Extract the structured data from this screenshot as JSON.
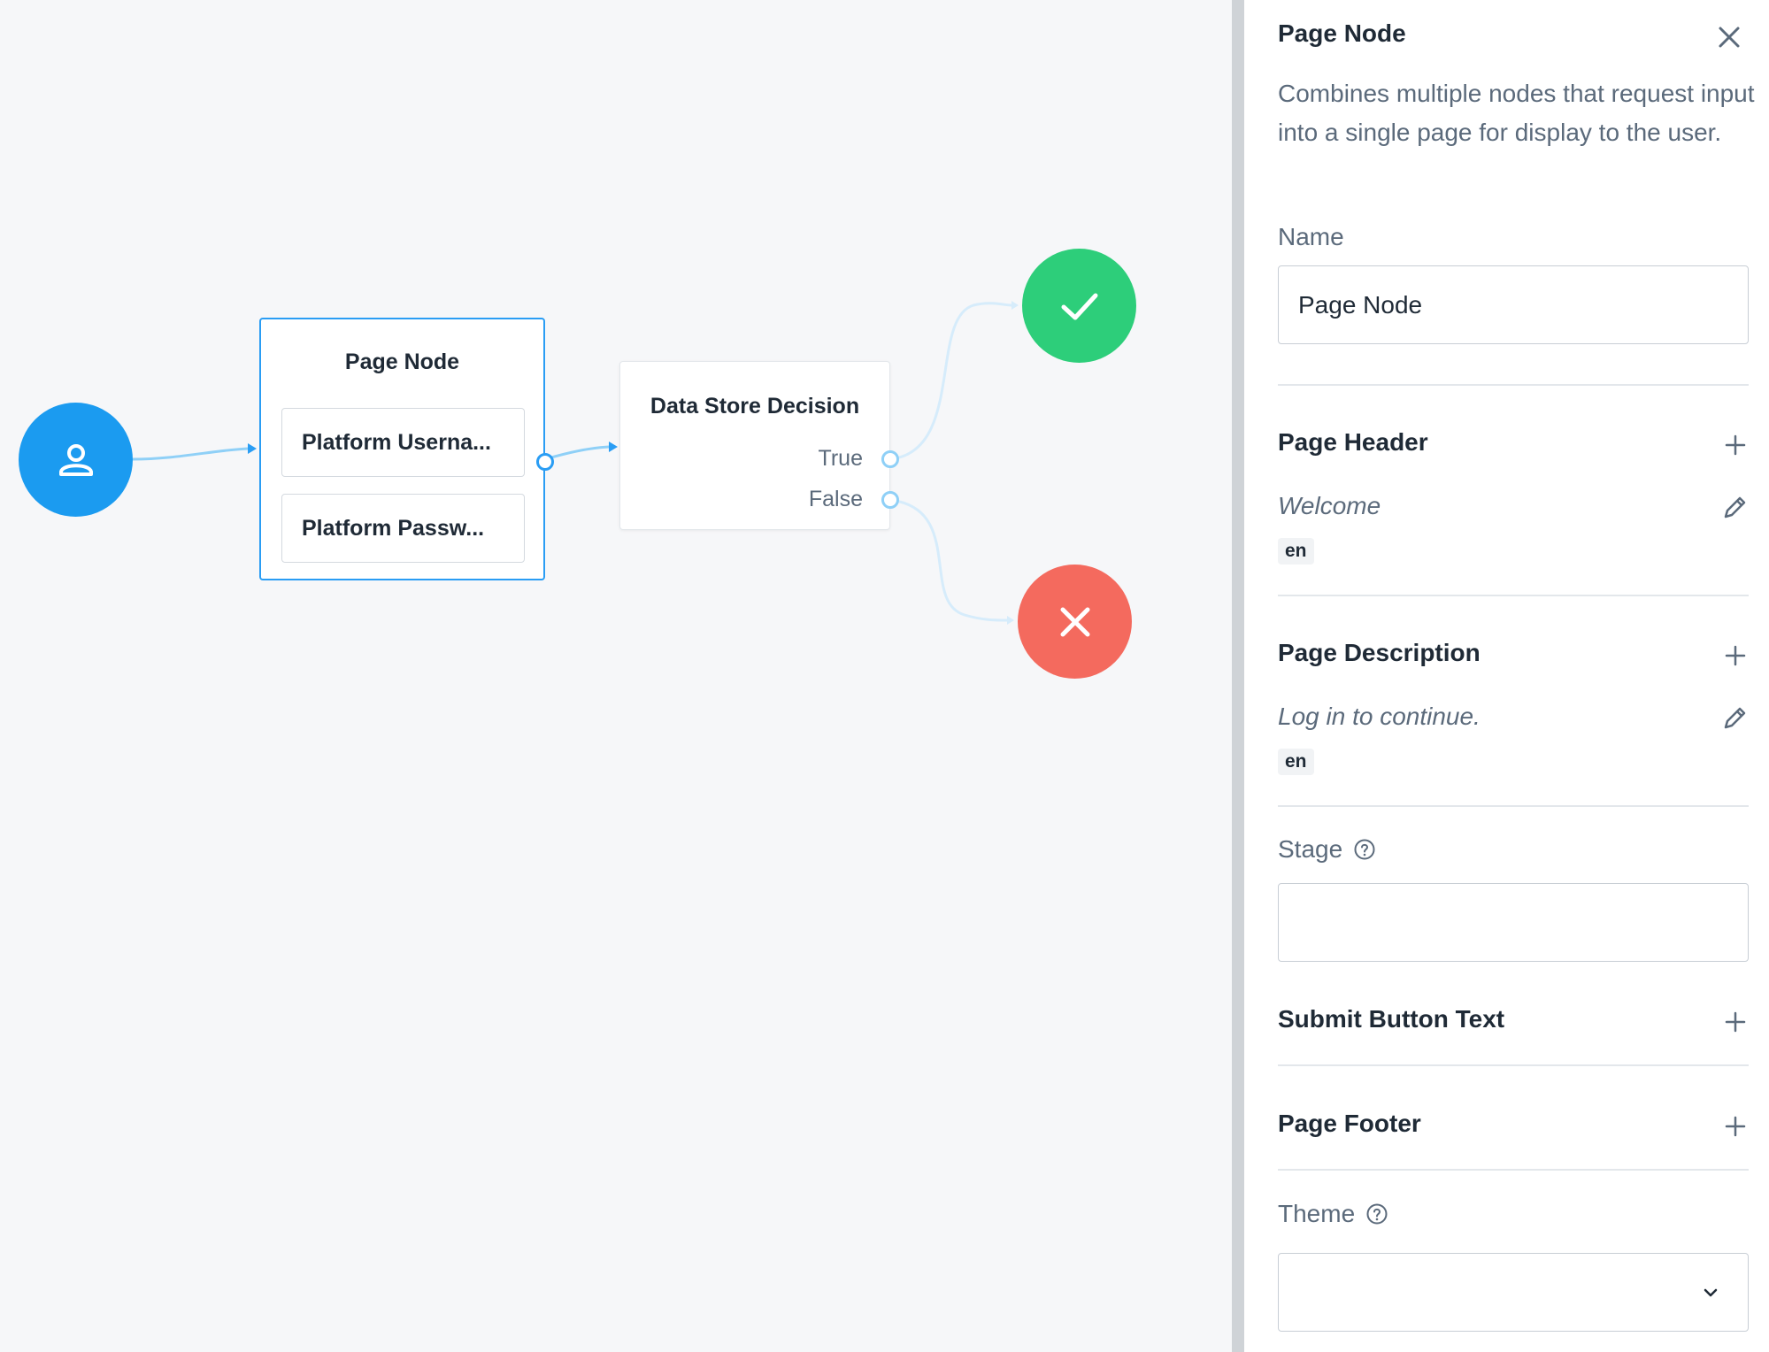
{
  "canvas": {
    "start_node": {
      "icon": "user-icon"
    },
    "page_node": {
      "title": "Page Node",
      "children": [
        "Platform Userna...",
        "Platform Passw..."
      ]
    },
    "decision_node": {
      "title": "Data Store Decision",
      "outcomes": [
        "True",
        "False"
      ]
    },
    "success_node": {
      "icon": "checkmark-icon",
      "color": "#2dce7a"
    },
    "failure_node": {
      "icon": "close-icon",
      "color": "#f46a5e"
    },
    "accent_color": "#1b9bf0"
  },
  "panel": {
    "title": "Page Node",
    "close_icon": "close-icon",
    "description": "Combines multiple nodes that request input into a single page for display to the user.",
    "name_label": "Name",
    "name_value": "Page Node",
    "page_header": {
      "title": "Page Header",
      "value": "Welcome",
      "lang": "en"
    },
    "page_description": {
      "title": "Page Description",
      "value": "Log in to continue.",
      "lang": "en"
    },
    "stage_label": "Stage",
    "stage_value": "",
    "submit_button_text": {
      "title": "Submit Button Text"
    },
    "page_footer": {
      "title": "Page Footer"
    },
    "theme_label": "Theme",
    "theme_value": ""
  }
}
